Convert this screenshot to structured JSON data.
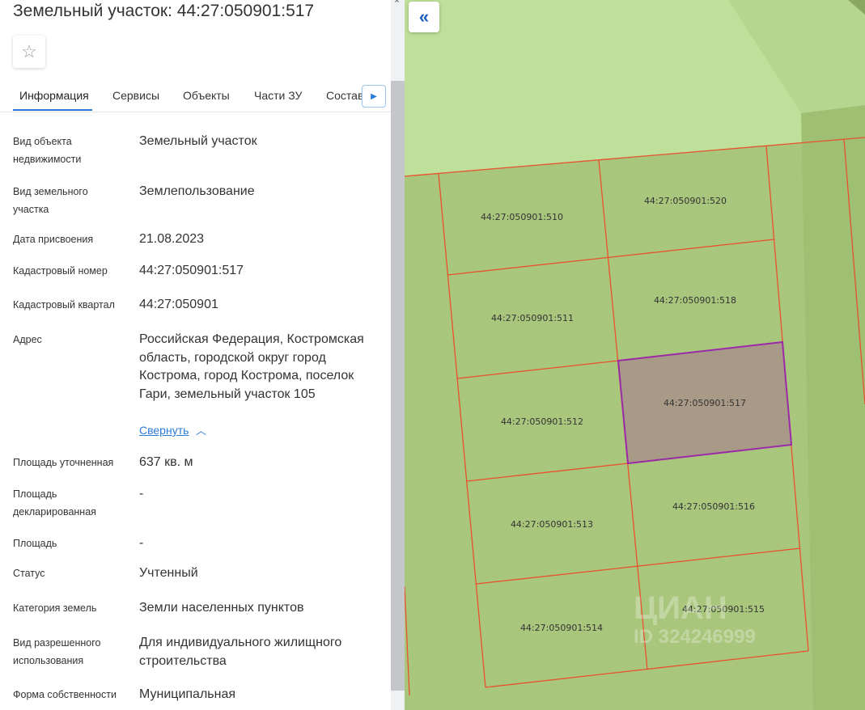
{
  "header": {
    "title": "Земельный участок: 44:27:050901:517",
    "favorite_icon": "star-icon"
  },
  "tabs": [
    {
      "label": "Информация",
      "active": true
    },
    {
      "label": "Сервисы"
    },
    {
      "label": "Объекты"
    },
    {
      "label": "Части ЗУ"
    },
    {
      "label": "Состав"
    }
  ],
  "tabs_next_icon": "caret-right-icon",
  "info": [
    {
      "label": "Вид объекта недвижимости",
      "value": "Земельный участок"
    },
    {
      "label": "Вид земельного участка",
      "value": "Землепользование"
    },
    {
      "label": "Дата присвоения",
      "value": "21.08.2023"
    },
    {
      "label": "Кадастровый номер",
      "value": "44:27:050901:517"
    },
    {
      "label": "Кадастровый квартал",
      "value": "44:27:050901"
    },
    {
      "label": "Адрес",
      "value": "Российская Федерация, Костромская область, городской округ город Кострома, город Кострома, поселок Гари, земельный участок 105"
    },
    {
      "label": "Площадь уточненная",
      "value": "637 кв. м"
    },
    {
      "label": "Площадь декларированная",
      "value": "-"
    },
    {
      "label": "Площадь",
      "value": "-"
    },
    {
      "label": "Статус",
      "value": "Учтенный"
    },
    {
      "label": "Категория земель",
      "value": "Земли населенных пунктов"
    },
    {
      "label": "Вид разрешенного использования",
      "value": "Для индивидуального жилищного строительства"
    },
    {
      "label": "Форма собственности",
      "value": "Муниципальная"
    }
  ],
  "address_toggle": {
    "label": "Свернуть",
    "icon": "chevron-up-icon"
  },
  "map": {
    "back_icon": "double-chevron-left-icon",
    "selected_parcel": "44:27:050901:517",
    "parcels": [
      "44:27:050901:510",
      "44:27:050901:520",
      "44:27:050901:511",
      "44:27:050901:518",
      "44:27:050901:512",
      "44:27:050901:517",
      "44:27:050901:513",
      "44:27:050901:516",
      "44:27:050901:514",
      "44:27:050901:515"
    ],
    "watermark": {
      "logo": "ЦИАН",
      "id": "ID 324246999"
    },
    "colors": {
      "light_green": "#bfe09a",
      "mid_green": "#a9c67d",
      "parcel_border": "#e8502f",
      "selected_fill": "#a89a86",
      "selected_border": "#9c2aa8"
    }
  }
}
